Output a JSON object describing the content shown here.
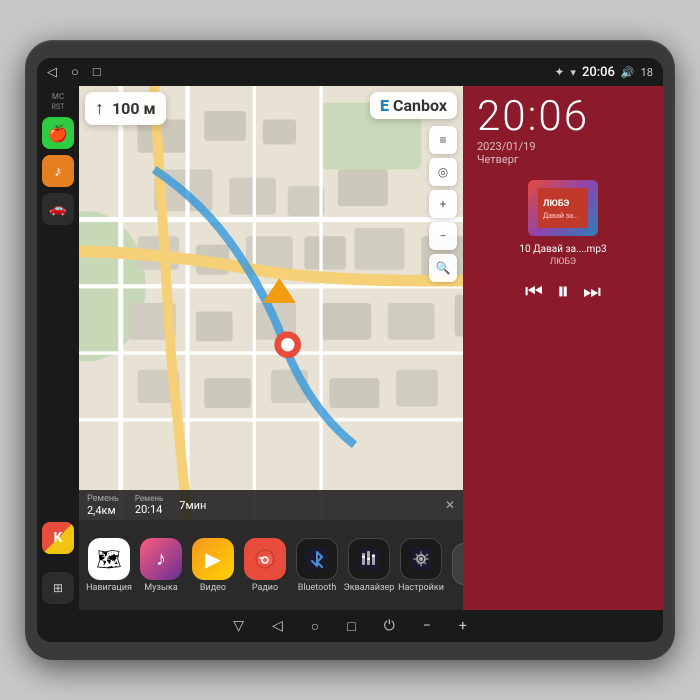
{
  "device": {
    "statusBar": {
      "backLabel": "◁",
      "circleLabel": "○",
      "squareLabel": "□",
      "bluetooth": "✦",
      "wifi": "▾",
      "volume": "🔊",
      "time": "20:06",
      "battery": "18"
    },
    "sidebar": {
      "mcLabel": "MC",
      "rstLabel": "RST",
      "carplayIcon": "🍎",
      "musicIcon": "♪",
      "carIcon": "🚗",
      "kIcon": "K"
    },
    "map": {
      "directionDist": "100 м",
      "logo": "Canbox",
      "logoPrefix": "E",
      "stat1Label": "2,4км",
      "stat1Sub": "Ремень",
      "stat2Label": "20:14",
      "stat3Label": "7мин",
      "closeBtn": "✕",
      "controls": [
        "≡",
        "🔍",
        "◎",
        "+",
        "−",
        "🔍"
      ]
    },
    "clock": {
      "time": "20:06",
      "date": "2023/01/19",
      "dayName": "Четверг"
    },
    "music": {
      "trackName": "10 Давай за....mp3",
      "artist": "ЛЮБЭ",
      "prevBtn": "⏮",
      "playBtn": "⏸",
      "nextBtn": "⏭"
    },
    "apps": [
      {
        "label": "Навигация",
        "type": "maps",
        "icon": "🗺"
      },
      {
        "label": "Музыка",
        "type": "music",
        "icon": "♪"
      },
      {
        "label": "Видео",
        "type": "video",
        "icon": "▶"
      },
      {
        "label": "Радио",
        "type": "radio",
        "icon": "📻"
      },
      {
        "label": "Bluetooth",
        "type": "bluetooth",
        "icon": "⚡"
      },
      {
        "label": "Эквалайзер",
        "type": "eq",
        "icon": "≡"
      },
      {
        "label": "Настройки",
        "type": "settings",
        "icon": "⚙"
      },
      {
        "label": "+",
        "type": "add",
        "icon": "+"
      }
    ],
    "sysNav": {
      "back": "▽",
      "backAlt": "◁",
      "home": "○",
      "recent": "□",
      "power": "⏻",
      "minus": "−",
      "plus": "+"
    }
  }
}
